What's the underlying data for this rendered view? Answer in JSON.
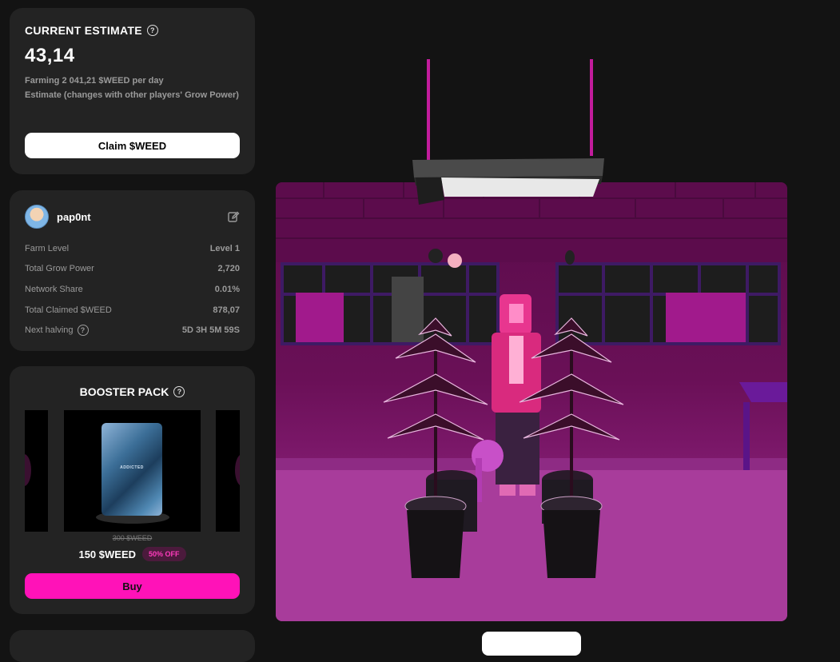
{
  "estimate": {
    "title": "CURRENT ESTIMATE",
    "value": "43,14",
    "farming_line": "Farming 2 041,21 $WEED per day",
    "note": "Estimate (changes with other players' Grow Power)",
    "claim_button": "Claim $WEED"
  },
  "profile": {
    "username": "pap0nt",
    "stats": [
      {
        "label": "Farm Level",
        "value": "Level 1"
      },
      {
        "label": "Total Grow Power",
        "value": "2,720"
      },
      {
        "label": "Network Share",
        "value": "0.01%"
      },
      {
        "label": "Total Claimed $WEED",
        "value": "878,07"
      },
      {
        "label": "Next halving",
        "value": "5D 3H 5M 59S"
      }
    ]
  },
  "booster": {
    "title": "BOOSTER PACK",
    "pack_label": "ADDICTED",
    "old_price": "300 $WEED",
    "price": "150 $WEED",
    "discount": "50% OFF",
    "buy_button": "Buy"
  },
  "colors": {
    "background": "#131313",
    "card": "#232323",
    "accent_pink": "#ff12b8",
    "scene_magenta": "#7a1768"
  },
  "icons": [
    "help-icon",
    "edit-icon",
    "avatar"
  ]
}
